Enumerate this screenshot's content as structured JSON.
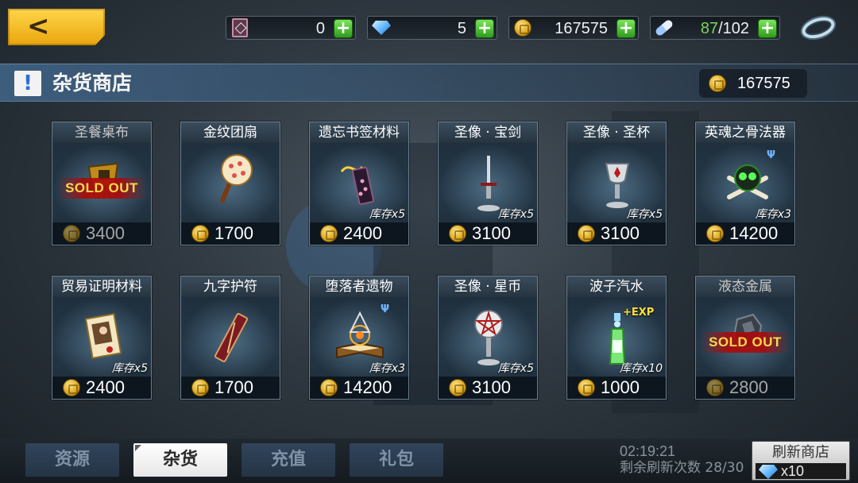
{
  "topbar": {
    "back_icon": "<",
    "resources": [
      {
        "name": "card",
        "icon": "card-icon",
        "value": "0"
      },
      {
        "name": "gem",
        "icon": "gem-icon",
        "value": "5"
      },
      {
        "name": "gold",
        "icon": "gold-coin-icon",
        "value": "167575"
      },
      {
        "name": "stamina",
        "icon": "stamina-pill-icon",
        "current": "87",
        "max": "/102"
      }
    ],
    "plus_label": "+"
  },
  "shop": {
    "title_badge": "!",
    "title": "杂货商店",
    "balance": "167575"
  },
  "items": [
    {
      "name": "圣餐桌布",
      "price": "3400",
      "stock": "",
      "sold_out": true
    },
    {
      "name": "金纹团扇",
      "price": "1700",
      "stock": "",
      "sold_out": false
    },
    {
      "name": "遗忘书签材料",
      "price": "2400",
      "stock": "库存x5",
      "sold_out": false
    },
    {
      "name": "圣像 · 宝剑",
      "price": "3100",
      "stock": "库存x5",
      "sold_out": false
    },
    {
      "name": "圣像 · 圣杯",
      "price": "3100",
      "stock": "库存x5",
      "sold_out": false
    },
    {
      "name": "英魂之骨法器",
      "price": "14200",
      "stock": "库存x3",
      "sold_out": false
    },
    {
      "name": "贸易证明材料",
      "price": "2400",
      "stock": "库存x5",
      "sold_out": false
    },
    {
      "name": "九字护符",
      "price": "1700",
      "stock": "",
      "sold_out": false
    },
    {
      "name": "堕落者遗物",
      "price": "14200",
      "stock": "库存x3",
      "sold_out": false
    },
    {
      "name": "圣像 · 星币",
      "price": "3100",
      "stock": "库存x5",
      "sold_out": false
    },
    {
      "name": "波子汽水",
      "price": "1000",
      "stock": "库存x10",
      "sold_out": false
    },
    {
      "name": "液态金属",
      "price": "2800",
      "stock": "",
      "sold_out": true
    }
  ],
  "labels": {
    "sold_out": "SOLD OUT",
    "exp": "+EXP"
  },
  "tabs": [
    {
      "label": "资源",
      "active": false
    },
    {
      "label": "杂货",
      "active": true
    },
    {
      "label": "充值",
      "active": false
    },
    {
      "label": "礼包",
      "active": false
    }
  ],
  "footer": {
    "timer": "02:19:21",
    "refresh_remaining": "剩余刷新次数 28/30",
    "refresh_button": "刷新商店",
    "refresh_cost": "x10"
  },
  "colors": {
    "accent_gold": "#f5b91f",
    "plus_green": "#3fbf2a",
    "stamina_green": "#7ed45a",
    "soldout_red": "#aa0a0a",
    "soldout_text": "#ffd84a",
    "rank_blue": "#6fb4ff"
  }
}
